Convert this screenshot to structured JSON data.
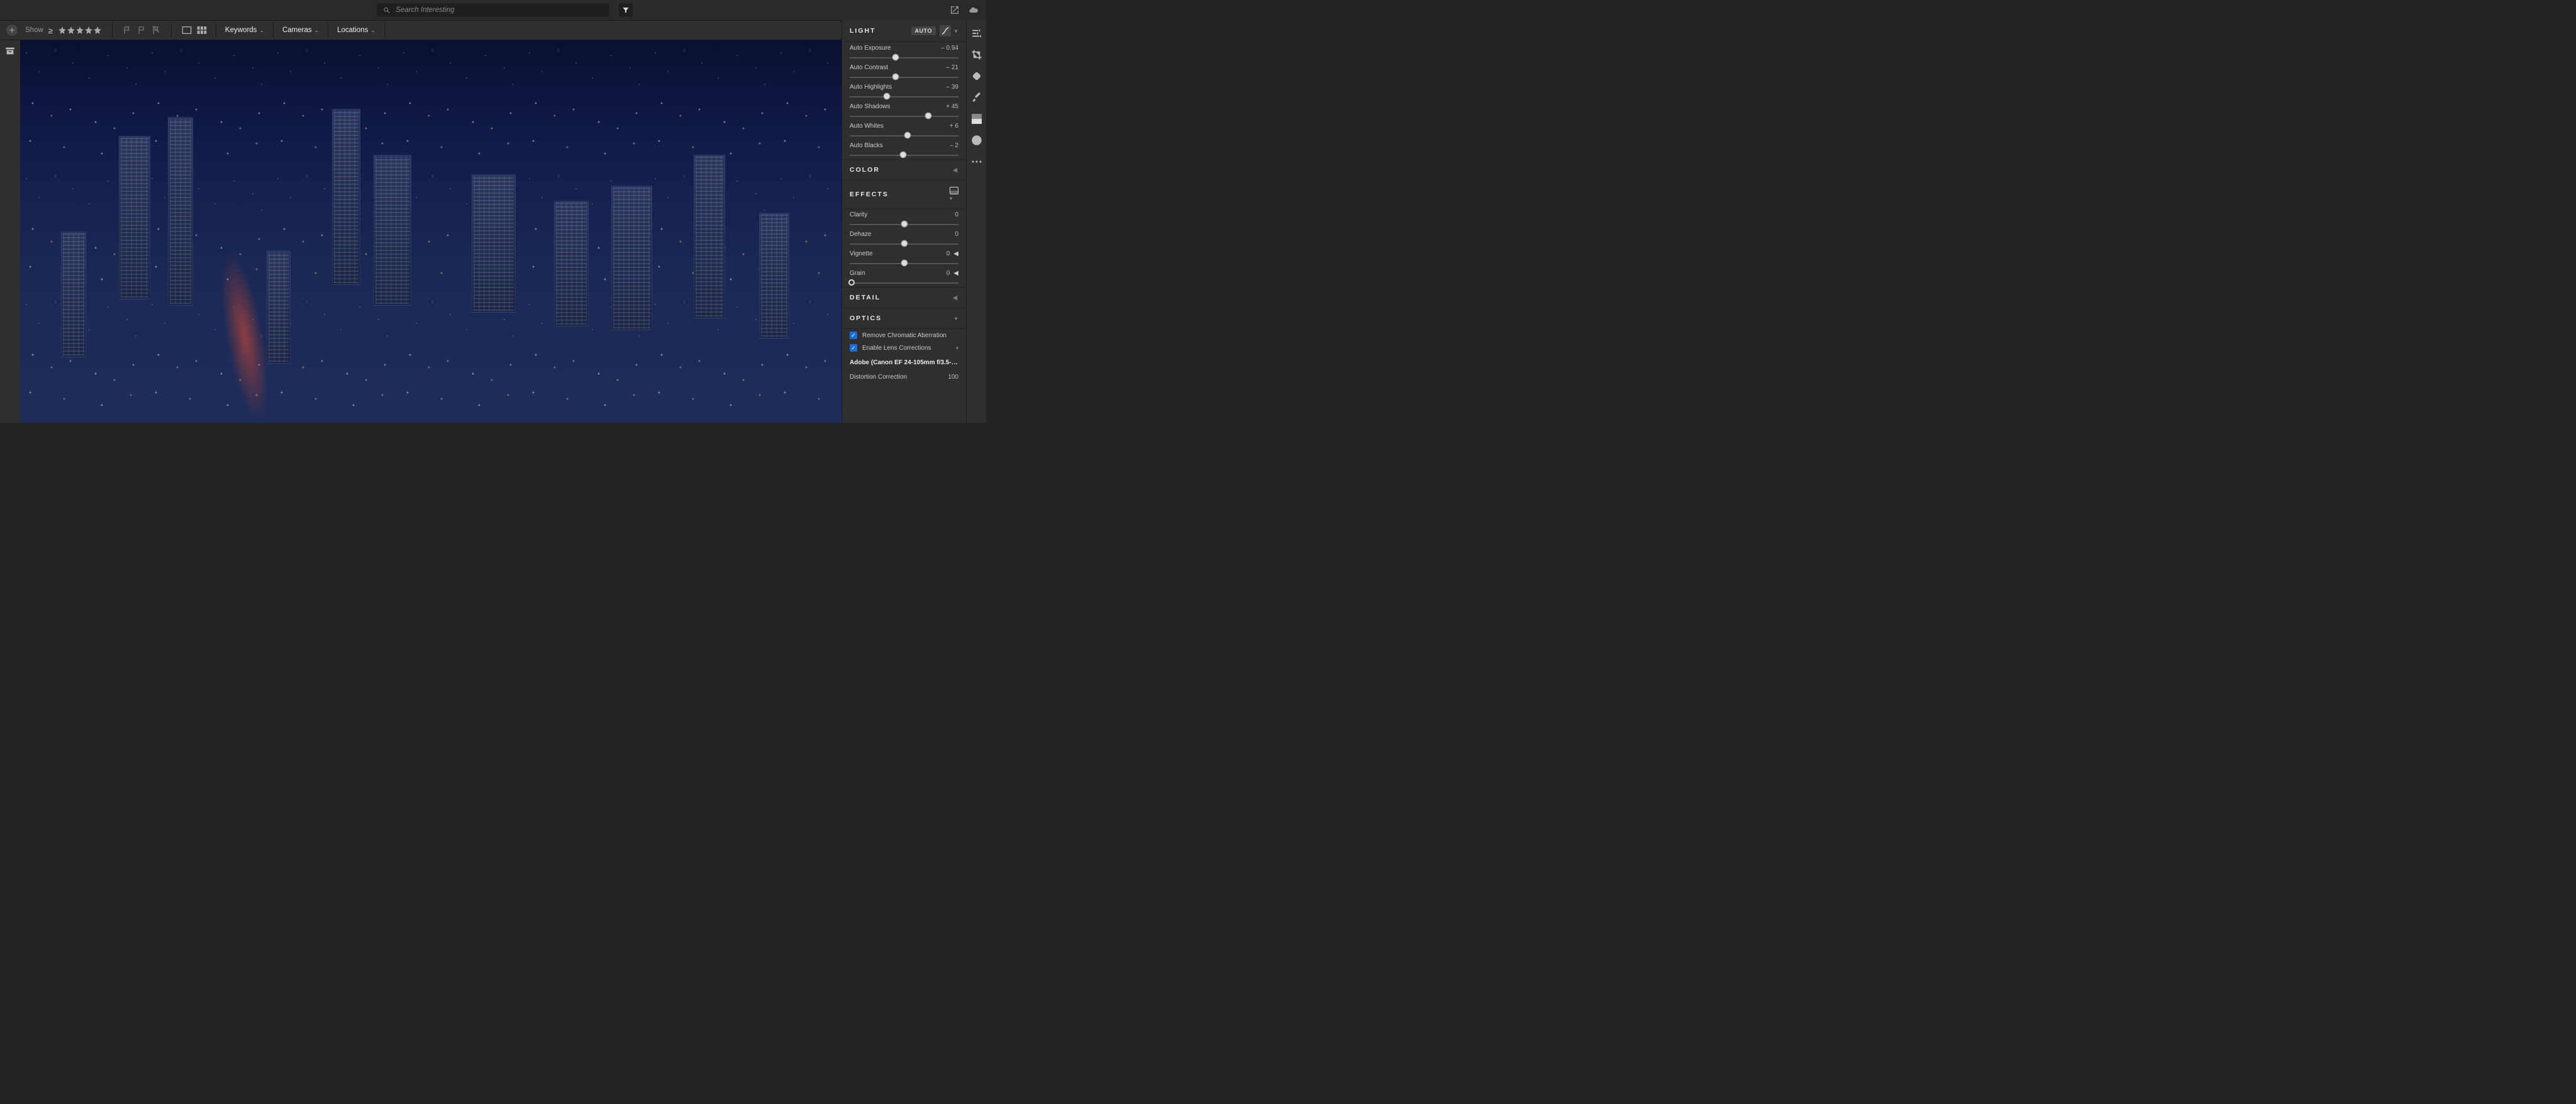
{
  "topbar": {
    "search_placeholder": "Search Interesting"
  },
  "filterbar": {
    "show_label": "Show",
    "keywords": "Keywords",
    "cameras": "Cameras",
    "locations": "Locations"
  },
  "panels": {
    "light": {
      "title": "LIGHT",
      "auto": "AUTO",
      "sliders": [
        {
          "label": "Auto Exposure",
          "value": "– 0.94",
          "pos": 42
        },
        {
          "label": "Auto Contrast",
          "value": "– 21",
          "pos": 42
        },
        {
          "label": "Auto Highlights",
          "value": "– 39",
          "pos": 34
        },
        {
          "label": "Auto Shadows",
          "value": "+ 45",
          "pos": 72
        },
        {
          "label": "Auto Whites",
          "value": "+ 6",
          "pos": 53
        },
        {
          "label": "Auto Blacks",
          "value": "– 2",
          "pos": 49
        }
      ]
    },
    "color": {
      "title": "COLOR"
    },
    "effects": {
      "title": "EFFECTS",
      "sliders": [
        {
          "label": "Clarity",
          "value": "0",
          "pos": 50,
          "expand": false
        },
        {
          "label": "Dehaze",
          "value": "0",
          "pos": 50,
          "expand": false
        },
        {
          "label": "Vignette",
          "value": "0",
          "pos": 50,
          "expand": true
        },
        {
          "label": "Grain",
          "value": "0",
          "pos": 2,
          "expand": true,
          "hollow": true
        }
      ]
    },
    "detail": {
      "title": "DETAIL"
    },
    "optics": {
      "title": "OPTICS",
      "remove_ca": "Remove Chromatic Aberration",
      "enable_lens": "Enable Lens Corrections",
      "lens_profile": "Adobe (Canon EF 24-105mm f/3.5-5.…",
      "distortion_label": "Distortion Correction",
      "distortion_value": "100"
    }
  }
}
